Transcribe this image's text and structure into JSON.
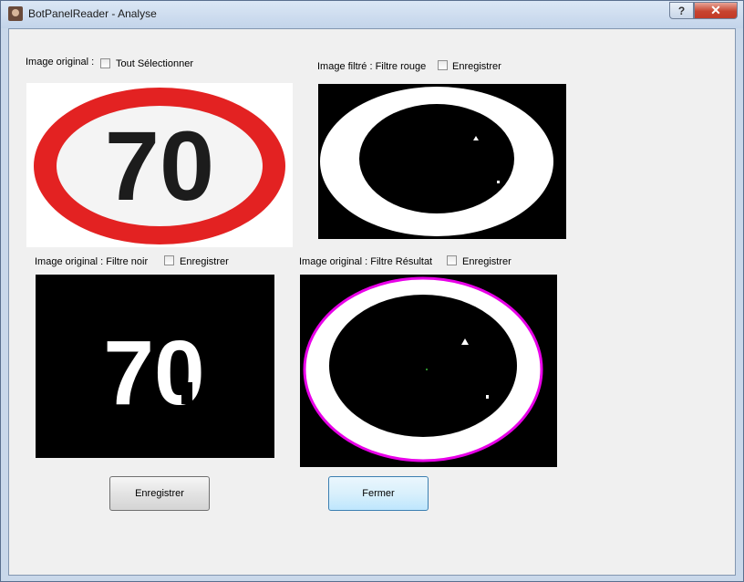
{
  "window": {
    "title": "BotPanelReader - Analyse",
    "help_label": "?",
    "close_label": "✕"
  },
  "panels": {
    "original": {
      "label": "Image original :",
      "checkbox_label": "Tout Sélectionner",
      "sign_text": "70",
      "colors": {
        "ring": "#e32222",
        "inner": "#f4f4f4",
        "text": "#1c1c1c"
      }
    },
    "filtre_rouge": {
      "label": "Image filtré : Filtre rouge",
      "checkbox_label": "Enregistrer"
    },
    "filtre_noir": {
      "label": "Image original : Filtre noir",
      "checkbox_label": "Enregistrer",
      "sign_text": "70"
    },
    "filtre_resultat": {
      "label": "Image original : Filtre Résultat",
      "checkbox_label": "Enregistrer",
      "colors": {
        "contour": "#e800e8"
      }
    }
  },
  "buttons": {
    "save_label": "Enregistrer",
    "close_label": "Fermer"
  }
}
